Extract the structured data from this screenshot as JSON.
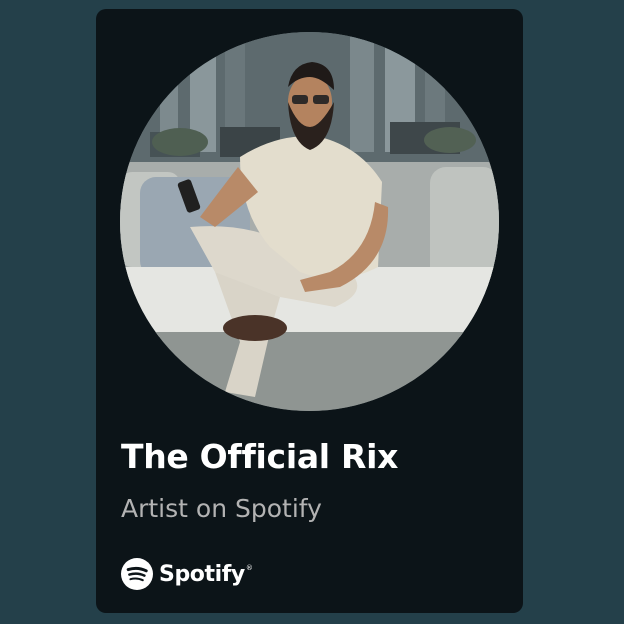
{
  "card": {
    "artist_name": "The Official Rix",
    "subtitle": "Artist on Spotify",
    "image_subject": "artist-photo"
  },
  "brand": {
    "name": "Spotify",
    "trademark": "®",
    "icon": "spotify-logo-icon",
    "logo_color": "#ffffff"
  },
  "colors": {
    "page_background": "#24404a",
    "card_background": "#0c1418",
    "title_text": "#ffffff",
    "subtitle_text": "#b3b3b3"
  }
}
